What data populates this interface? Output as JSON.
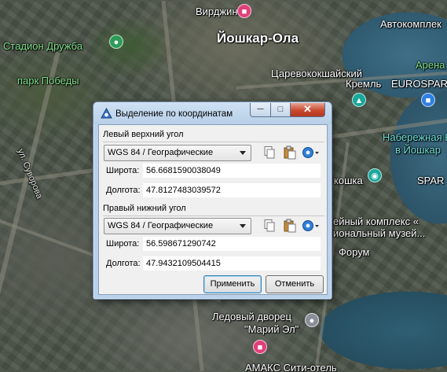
{
  "map": {
    "labels": {
      "virginia": "Вирджиния",
      "city": "Йошкар-Ола",
      "autocomplex": "Автокомплек",
      "stadium": "Стадион Дружба",
      "arena": "Арена",
      "park": "парк Победы",
      "tsarevo_line1": "Царевококшайский",
      "tsarevo_line2": "Кремль",
      "eurospar": "EUROSPAR",
      "embank_line1": "Набережная Бр",
      "embank_line2": "в Йошкар",
      "spar": "SPAR",
      "suvorova": "ул. Суворова",
      "kosha": "кошка",
      "museum_line1": "ейный комплекс «",
      "museum_line2": "иональный музей...",
      "forum": "Форум",
      "palace_line1": "Ледовый дворец",
      "palace_line2": "\"Марий Эл\"",
      "amaks": "АМАКС Сити-отель"
    }
  },
  "dialog": {
    "title": "Выделение по координатам",
    "top_left": {
      "group_label": "Левый верхний угол",
      "crs": "WGS 84 / Географические",
      "lat_label": "Широта:",
      "lat_value": "56.6681590038049",
      "lon_label": "Долгота:",
      "lon_value": "47.8127483039572"
    },
    "bottom_right": {
      "group_label": "Правый нижний угол",
      "crs": "WGS 84 / Географические",
      "lat_label": "Широта:",
      "lat_value": "56.598671290742",
      "lon_label": "Долгота:",
      "lon_value": "47.9432109504415"
    },
    "apply_label": "Применить",
    "cancel_label": "Отменить"
  }
}
